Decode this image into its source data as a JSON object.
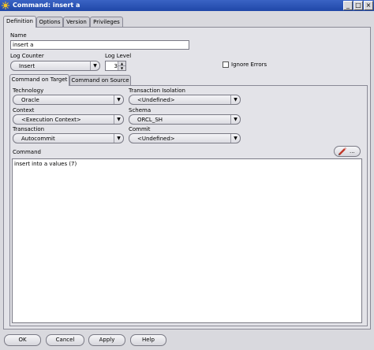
{
  "window": {
    "title": "Command: insert a",
    "controls": {
      "minimize": "_",
      "maximize": "□",
      "close": "×"
    }
  },
  "tabs": [
    {
      "label": "Definition"
    },
    {
      "label": "Options"
    },
    {
      "label": "Version"
    },
    {
      "label": "Privileges"
    }
  ],
  "definition": {
    "name_label": "Name",
    "name_value": "insert a",
    "log_counter_label": "Log Counter",
    "log_counter_value": "Insert",
    "log_level_label": "Log Level",
    "log_level_value": "3",
    "ignore_errors_label": "Ignore Errors",
    "ignore_errors_checked": false
  },
  "subtabs": [
    {
      "label": "Command on Target"
    },
    {
      "label": "Command on Source"
    }
  ],
  "target": {
    "technology_label": "Technology",
    "technology_value": "Oracle",
    "transaction_isolation_label": "Transaction Isolation",
    "transaction_isolation_value": "<Undefined>",
    "context_label": "Context",
    "context_value": "<Execution Context>",
    "schema_label": "Schema",
    "schema_value": "ORCL_SH",
    "transaction_label": "Transaction",
    "transaction_value": "Autocommit",
    "commit_label": "Commit",
    "commit_value": "<Undefined>",
    "command_label": "Command",
    "edit_button_label": "...",
    "command_text": "insert into a values (7)"
  },
  "footer": {
    "ok": "OK",
    "cancel": "Cancel",
    "apply": "Apply",
    "help": "Help"
  },
  "icons": {
    "dropdown_arrow": "▼",
    "spin_up": "▲",
    "spin_down": "▼",
    "window_icon": "sun-icon",
    "edit_icon": "pencil-icon"
  },
  "colors": {
    "titlebar": "#2a55b8",
    "background": "#d9d9de",
    "panel": "#e3e3e8"
  }
}
